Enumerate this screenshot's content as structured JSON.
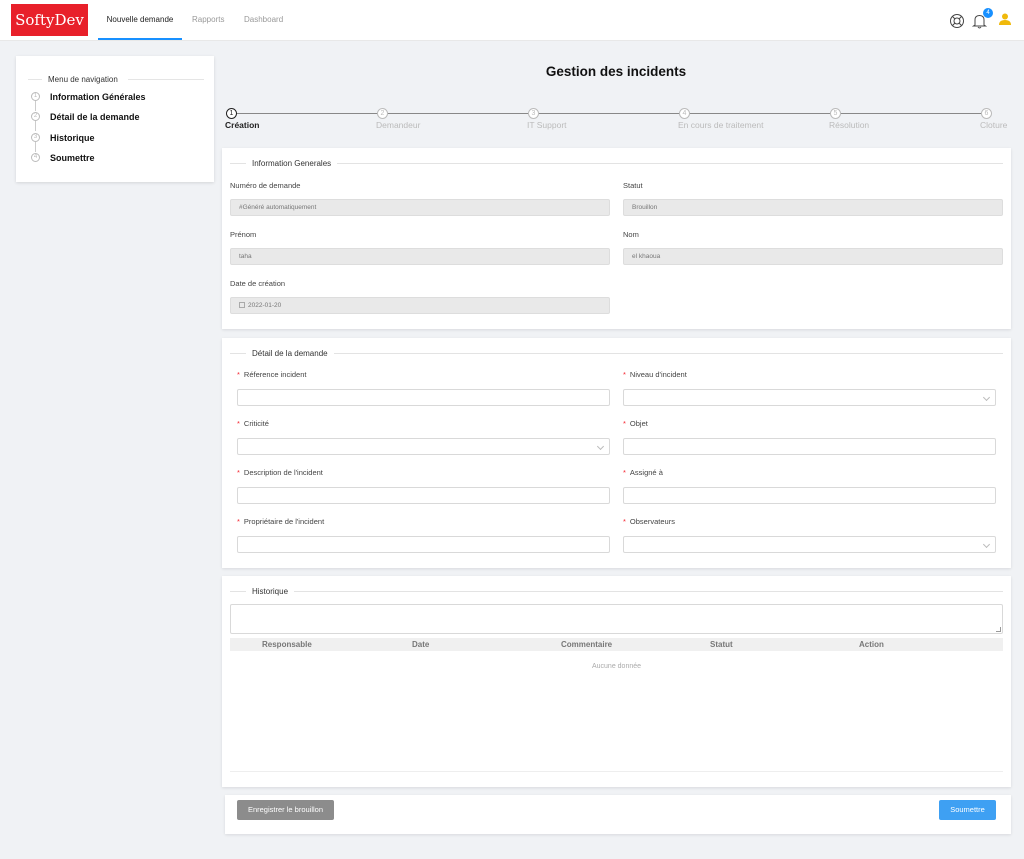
{
  "header": {
    "logo": "SoftyDev",
    "nav": [
      "Nouvelle demande",
      "Rapports",
      "Dashboard"
    ],
    "notification_count": "4"
  },
  "sidebar": {
    "title": "Menu de navigation",
    "items": [
      {
        "num": "1",
        "label": "Information Générales"
      },
      {
        "num": "2",
        "label": "Détail de la demande"
      },
      {
        "num": "3",
        "label": "Historique"
      },
      {
        "num": "4",
        "label": "Soumettre"
      }
    ]
  },
  "page_title": "Gestion des incidents",
  "steps": [
    {
      "num": "1",
      "label": "Création",
      "current": true
    },
    {
      "num": "2",
      "label": "Demandeur"
    },
    {
      "num": "3",
      "label": "IT Support"
    },
    {
      "num": "4",
      "label": "En cours de traitement"
    },
    {
      "num": "5",
      "label": "Résolution"
    },
    {
      "num": "6",
      "label": "Cloture"
    }
  ],
  "info": {
    "legend": "Information Generales",
    "numero_label": "Numéro de demande",
    "numero_value": "#Généré automatiquement",
    "statut_label": "Statut",
    "statut_value": "Brouillon",
    "prenom_label": "Prénom",
    "prenom_value": "taha",
    "nom_label": "Nom",
    "nom_value": "el khaoua",
    "date_label": "Date de création",
    "date_value": "2022-01-20"
  },
  "detail": {
    "legend": "Détail de la demande",
    "reference_label": "Réference incident",
    "niveau_label": "Niveau d'incident",
    "criticite_label": "Criticité",
    "objet_label": "Objet",
    "description_label": "Description de l'incident",
    "assigne_label": "Assigné à",
    "proprietaire_label": "Propriétaire de l'incident",
    "observateurs_label": "Observateurs"
  },
  "historique": {
    "legend": "Historique",
    "columns": [
      "Responsable",
      "Date",
      "Commentaire",
      "Statut",
      "Action"
    ],
    "empty": "Aucune donnée"
  },
  "actions": {
    "draft": "Enregistrer le brouillon",
    "submit": "Soumettre"
  }
}
